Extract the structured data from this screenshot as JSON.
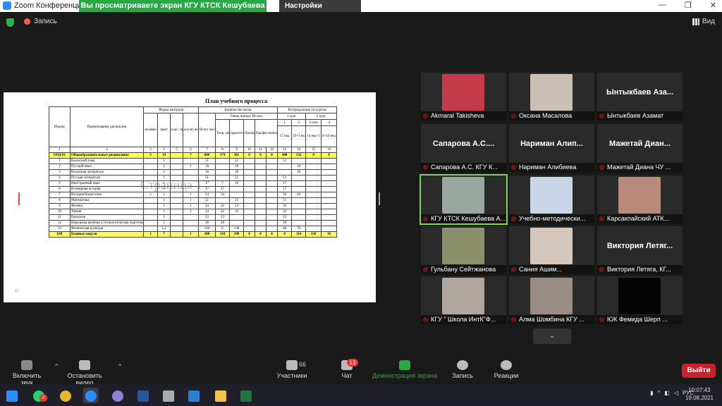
{
  "titlebar": {
    "app_title": "Zoom Конференция",
    "share_banner": "Вы просматриваете экран КГУ КТСК Кешубаева Айгерим",
    "view_options": "Настройки просмотра ⌄",
    "min": "—",
    "max": "❐",
    "close": "✕"
  },
  "meeting": {
    "record_label": "Запись",
    "view_label": "Вид"
  },
  "document": {
    "title": "План учебного процесса",
    "watermark": "Страница 1",
    "page_mark": "13",
    "header": {
      "index": "Индекс",
      "discipline": "Наименование дисциплин",
      "control_form": "Форма контроля",
      "exam": "экзамен",
      "credit": "зачет",
      "course_work": "курс. проект/ работа",
      "control_works": "кол-во контрольных работ",
      "hours_count": "Количество часов",
      "total": "Всего часов",
      "of_them": "Оның ішінде/ Из них",
      "theory": "Теор. занятия",
      "practice": "практич. занятия",
      "production": "Производственное обучение",
      "prof_practice": "Профессиональная практика",
      "distribution": "Распределение по курсам",
      "course1": "1 курс",
      "course2": "2 курс",
      "sem1": "1",
      "sem2": "2",
      "sem3": "3 сем.",
      "sem4": "4",
      "w1": "17 нед",
      "w2": "19+3 нед",
      "w3": "14 нед+5 нед",
      "w4": "8+10 нед"
    },
    "colnums": [
      "1",
      "2",
      "3",
      "4",
      "5",
      "6",
      "7",
      "8",
      "9",
      "10",
      "11",
      "12",
      "13",
      "14",
      "15",
      "16"
    ],
    "rows": [
      {
        "c": [
          "ООД 01",
          "Общеобразовательные дисциплины",
          "3",
          "14",
          "",
          "7",
          "840",
          "179",
          "361",
          "0",
          "0",
          "0",
          "408",
          "132",
          "0",
          "0"
        ],
        "hl": true
      },
      {
        "c": [
          "1",
          "Казахский язык",
          "",
          "1",
          "",
          "",
          "51",
          "",
          "51",
          "",
          "",
          "",
          "51",
          "",
          "",
          ""
        ]
      },
      {
        "c": [
          "2",
          "Русский язык",
          "",
          "2",
          "",
          "1",
          "18",
          "",
          "18",
          "",
          "",
          "",
          "",
          "18",
          "",
          ""
        ]
      },
      {
        "c": [
          "3",
          "Казахская литература",
          "",
          "2",
          "",
          "",
          "18",
          "",
          "18",
          "",
          "",
          "",
          "",
          "18",
          "",
          ""
        ]
      },
      {
        "c": [
          "4",
          "Русская литература",
          "",
          "1",
          "",
          "",
          "51",
          "",
          "51",
          "",
          "",
          "",
          "51",
          "",
          "",
          ""
        ]
      },
      {
        "c": [
          "5",
          "Иностранный язык",
          "",
          "1",
          "",
          "",
          "17",
          "7",
          "10",
          "",
          "",
          "",
          "17",
          "",
          "",
          ""
        ]
      },
      {
        "c": [
          "6",
          "Всемирная история",
          "",
          "1",
          "",
          "",
          "17",
          "17",
          "",
          "",
          "",
          "",
          "17",
          "",
          "",
          ""
        ]
      },
      {
        "c": [
          "7",
          "История Казахстана",
          "2",
          "1",
          "",
          "1",
          "54",
          "54",
          "",
          "",
          "",
          "",
          "34",
          "20",
          "",
          ""
        ]
      },
      {
        "c": [
          "8",
          "Математика",
          "",
          "1",
          "",
          "1",
          "51",
          "",
          "51",
          "",
          "",
          "",
          "51",
          "",
          "",
          ""
        ]
      },
      {
        "c": [
          "9",
          "Физика",
          "",
          "1",
          "",
          "1",
          "34",
          "22",
          "12",
          "",
          "",
          "",
          "34",
          "",
          "",
          ""
        ]
      },
      {
        "c": [
          "10",
          "Химия",
          "",
          "1",
          "",
          "1",
          "34",
          "22",
          "12",
          "",
          "",
          "",
          "34",
          "",
          "",
          ""
        ]
      },
      {
        "c": [
          "11",
          "Биология",
          "",
          "1",
          "",
          "",
          "23",
          "23",
          "",
          "",
          "",
          "",
          "23",
          "",
          "",
          ""
        ]
      },
      {
        "c": [
          "12",
          "Начальная военная и технологическая подготовка",
          "",
          "1",
          "",
          "",
          "28",
          "28",
          "",
          "",
          "",
          "",
          "28",
          "",
          "",
          ""
        ]
      },
      {
        "c": [
          "13",
          "Физическая культура",
          "",
          "1,2",
          "",
          "",
          "144",
          "6",
          "138",
          "",
          "",
          "",
          "68",
          "76",
          "",
          ""
        ]
      },
      {
        "c": [
          "БМ",
          "Базовые модули",
          "1",
          "7",
          "",
          "1",
          "308",
          "118",
          "190",
          "0",
          "0",
          "0",
          "0",
          "114",
          "158",
          "36"
        ],
        "hl": true
      }
    ]
  },
  "gallery": [
    {
      "name": "Akmaral Takisheva",
      "big": "",
      "video": "#c33a4a"
    },
    {
      "name": "Оксана Масалова",
      "big": "",
      "video": "#c9bfb3"
    },
    {
      "name": "Ынтыкбаев Азамат",
      "big": "Ынтыкбаев Аза...",
      "video": ""
    },
    {
      "name": "Сапарова А.С. КГУ К...",
      "big": "Сапарова А.С....",
      "video": ""
    },
    {
      "name": "Нариман Алибиева",
      "big": "Нариман Алип...",
      "video": ""
    },
    {
      "name": "Мажетай Диана ЧУ ...",
      "big": "Мажетай Диан...",
      "video": ""
    },
    {
      "name": "КГУ КТСК Кешубаева А...",
      "big": "",
      "video": "#9aa7a0",
      "active": true
    },
    {
      "name": "Учебно-методически...",
      "big": "",
      "video": "#c8d6e8"
    },
    {
      "name": "Карсакпайский АТК...",
      "big": "",
      "video": "#b98a7c"
    },
    {
      "name": "Гульбану Сейтжанова",
      "big": "",
      "video": "#8b8f6a"
    },
    {
      "name": "Сания Ашим...",
      "big": "",
      "video": "#d6c7bd"
    },
    {
      "name": "Виктория Летяга, КГ...",
      "big": "Виктория Летяг...",
      "video": ""
    },
    {
      "name": "КГУ \" Школа ИнтК\"Ф...",
      "big": "",
      "video": "#b0a89e"
    },
    {
      "name": "Алма Шомбина КГУ ...",
      "big": "",
      "video": "#9a8c82"
    },
    {
      "name": "ЮК Фемида Шерп ...",
      "big": "",
      "video": "#050505"
    }
  ],
  "gallery_more": "⌄",
  "toolbar": {
    "unmute": "Включить звук",
    "video": "Остановить видео",
    "participants": "Участники",
    "participants_count": "66",
    "chat": "Чат",
    "chat_badge": "13",
    "share": "Демонстрация экрана",
    "record": "Запись",
    "reactions": "Реакции",
    "leave": "Выйти"
  },
  "taskbar": {
    "wa_badge": "2",
    "lang": "РУС",
    "time": "10:07:43",
    "date": "19.08.2021"
  }
}
